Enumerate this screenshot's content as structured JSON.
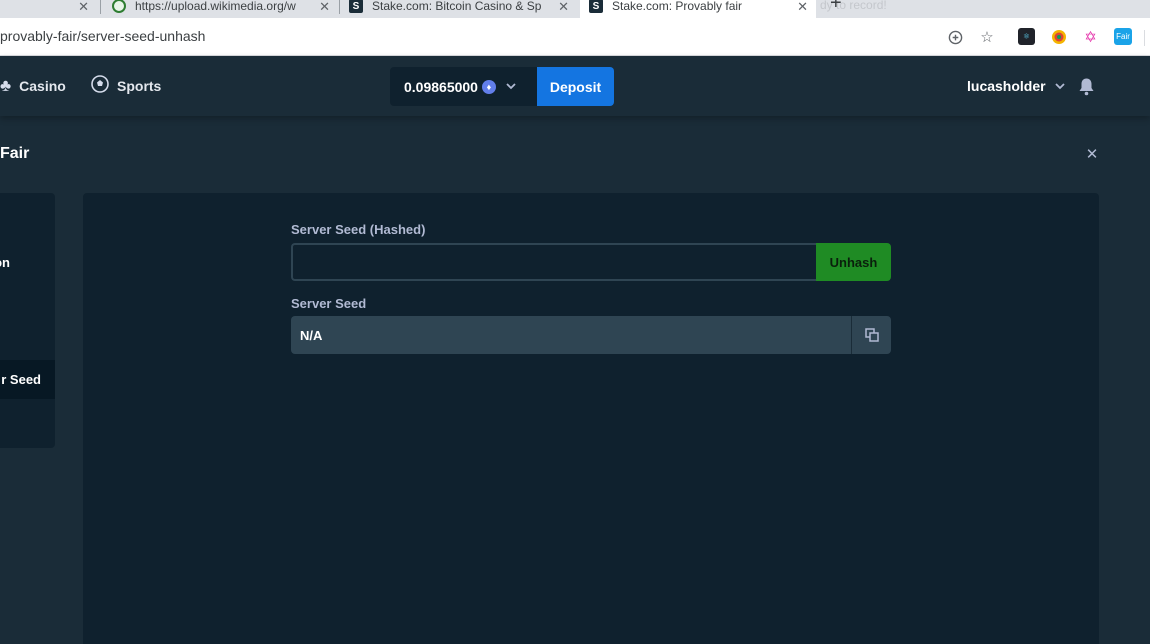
{
  "browser": {
    "tabs": [
      {
        "title": "https://upload.wikimedia.org/w",
        "favicon": "globe-icon"
      },
      {
        "title": "Stake.com: Bitcoin Casino & Sp",
        "favicon": "stake-s-icon"
      },
      {
        "title": "Stake.com: Provably fair",
        "favicon": "stake-s-icon",
        "active": true
      }
    ],
    "ghost_text": "dy to record!",
    "url": "provably-fair/server-seed-unhash"
  },
  "header": {
    "nav": [
      {
        "label": "Casino",
        "icon": "club-icon"
      },
      {
        "label": "Sports",
        "icon": "soccer-ball-icon"
      }
    ],
    "balance": "0.09865000",
    "currency_icon": "ethereum-icon",
    "deposit_label": "Deposit",
    "username": "lucasholder"
  },
  "modal": {
    "title": "Fair",
    "sidebar": [
      {
        "label": "on"
      },
      {
        "label": "r Seed",
        "active": true
      }
    ],
    "form": {
      "hashed_label": "Server Seed (Hashed)",
      "hashed_value": "",
      "unhash_label": "Unhash",
      "seed_label": "Server Seed",
      "seed_value": "N/A"
    }
  },
  "colors": {
    "background": "#1a2c38",
    "panel": "#0f212e",
    "input": "#2f4553",
    "deposit": "#1475e1",
    "unhash": "#1f8b24"
  }
}
